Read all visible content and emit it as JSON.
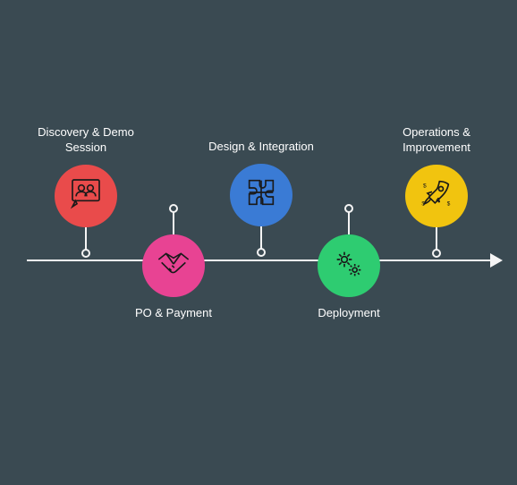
{
  "steps": [
    {
      "label": "Discovery & Demo\nSession",
      "icon": "presentation-people-icon",
      "color": "#e94b4b",
      "position": "top"
    },
    {
      "label": "PO & Payment",
      "icon": "handshake-icon",
      "color": "#e84393",
      "position": "bottom"
    },
    {
      "label": "Design & Integration",
      "icon": "puzzle-icon",
      "color": "#3a7bd5",
      "position": "top"
    },
    {
      "label": "Deployment",
      "icon": "gears-icon",
      "color": "#2ecc71",
      "position": "bottom"
    },
    {
      "label": "Operations &\nImprovement",
      "icon": "rocket-launch-icon",
      "color": "#f1c40f",
      "position": "top"
    }
  ]
}
